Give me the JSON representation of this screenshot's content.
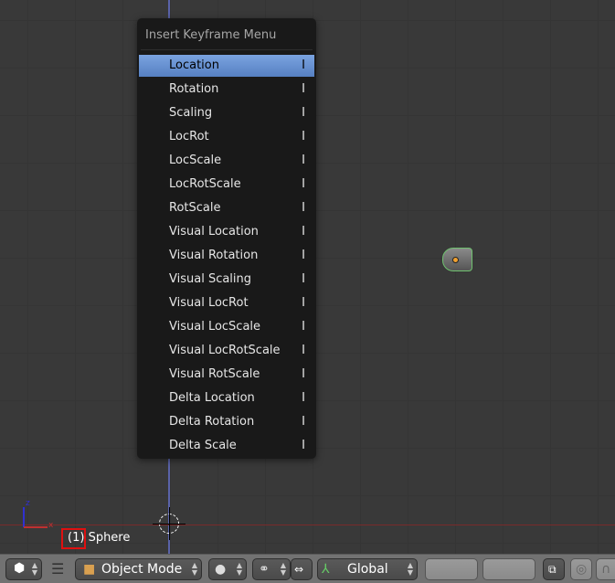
{
  "menu": {
    "title": "Insert Keyframe Menu",
    "items": [
      {
        "label": "Location",
        "shortcut": "I",
        "active": true
      },
      {
        "label": "Rotation",
        "shortcut": "I"
      },
      {
        "label": "Scaling",
        "shortcut": "I"
      },
      {
        "label": "LocRot",
        "shortcut": "I"
      },
      {
        "label": "LocScale",
        "shortcut": "I"
      },
      {
        "label": "LocRotScale",
        "shortcut": "I"
      },
      {
        "label": "RotScale",
        "shortcut": "I"
      },
      {
        "label": "Visual Location",
        "shortcut": "I"
      },
      {
        "label": "Visual Rotation",
        "shortcut": "I"
      },
      {
        "label": "Visual Scaling",
        "shortcut": "I"
      },
      {
        "label": "Visual LocRot",
        "shortcut": "I"
      },
      {
        "label": "Visual LocScale",
        "shortcut": "I"
      },
      {
        "label": "Visual LocRotScale",
        "shortcut": "I"
      },
      {
        "label": "Visual RotScale",
        "shortcut": "I"
      },
      {
        "label": "Delta Location",
        "shortcut": "I"
      },
      {
        "label": "Delta Rotation",
        "shortcut": "I"
      },
      {
        "label": "Delta Scale",
        "shortcut": "I"
      }
    ]
  },
  "viewport": {
    "frame": "(1)",
    "object_name": "Sphere",
    "axis_z": "z",
    "axis_x": "x"
  },
  "toolbar": {
    "mode": "Object Mode",
    "orientation": "Global"
  }
}
